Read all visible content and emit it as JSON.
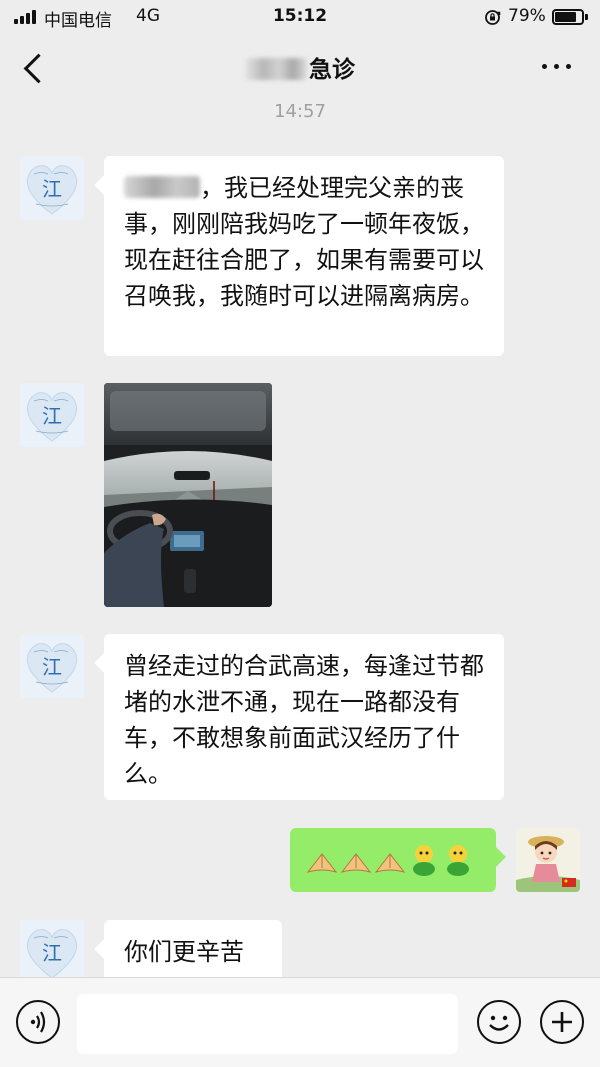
{
  "status_bar": {
    "carrier": "中国电信",
    "network": "4G",
    "time": "15:12",
    "battery_percent_text": "79%",
    "battery_level": 0.79,
    "icons": [
      "signal-icon",
      "orientation-lock-icon",
      "battery-icon"
    ]
  },
  "nav": {
    "title": "急诊",
    "back_icon": "chevron-left-icon",
    "more_icon": "more-dots-icon"
  },
  "chat": {
    "timestamp": "14:57",
    "messages": [
      {
        "sender": "contact",
        "type": "text",
        "text_after_redaction": "，我已经处理完父亲的丧事，刚刚陪我妈吃了一顿年夜饭，现在赶往合肥了，如果有需要可以召唤我，我随时可以进隔离病房。"
      },
      {
        "sender": "contact",
        "type": "image",
        "content": "photo-driving-on-highway"
      },
      {
        "sender": "contact",
        "type": "text",
        "text": "曾经走过的合武高速，每逢过节都堵的水泄不通，现在一路都没有车，不敢想象前面武汉经历了什么。"
      },
      {
        "sender": "me",
        "type": "emoji",
        "emojis": [
          "salute-hands-icon",
          "salute-hands-icon",
          "salute-hands-icon",
          "green-bean-sprite-icon",
          "green-bean-sprite-icon"
        ]
      },
      {
        "sender": "contact",
        "type": "text",
        "text": "你们更辛苦"
      }
    ],
    "contact_avatar_glyph": "江"
  },
  "input_bar": {
    "voice_icon": "voice-icon",
    "emoji_icon": "smiley-icon",
    "plus_icon": "plus-icon",
    "text_value": ""
  },
  "colors": {
    "background": "#ededed",
    "bubble_in": "#ffffff",
    "bubble_out": "#95ec69",
    "timestamp": "#a0a0a0"
  }
}
